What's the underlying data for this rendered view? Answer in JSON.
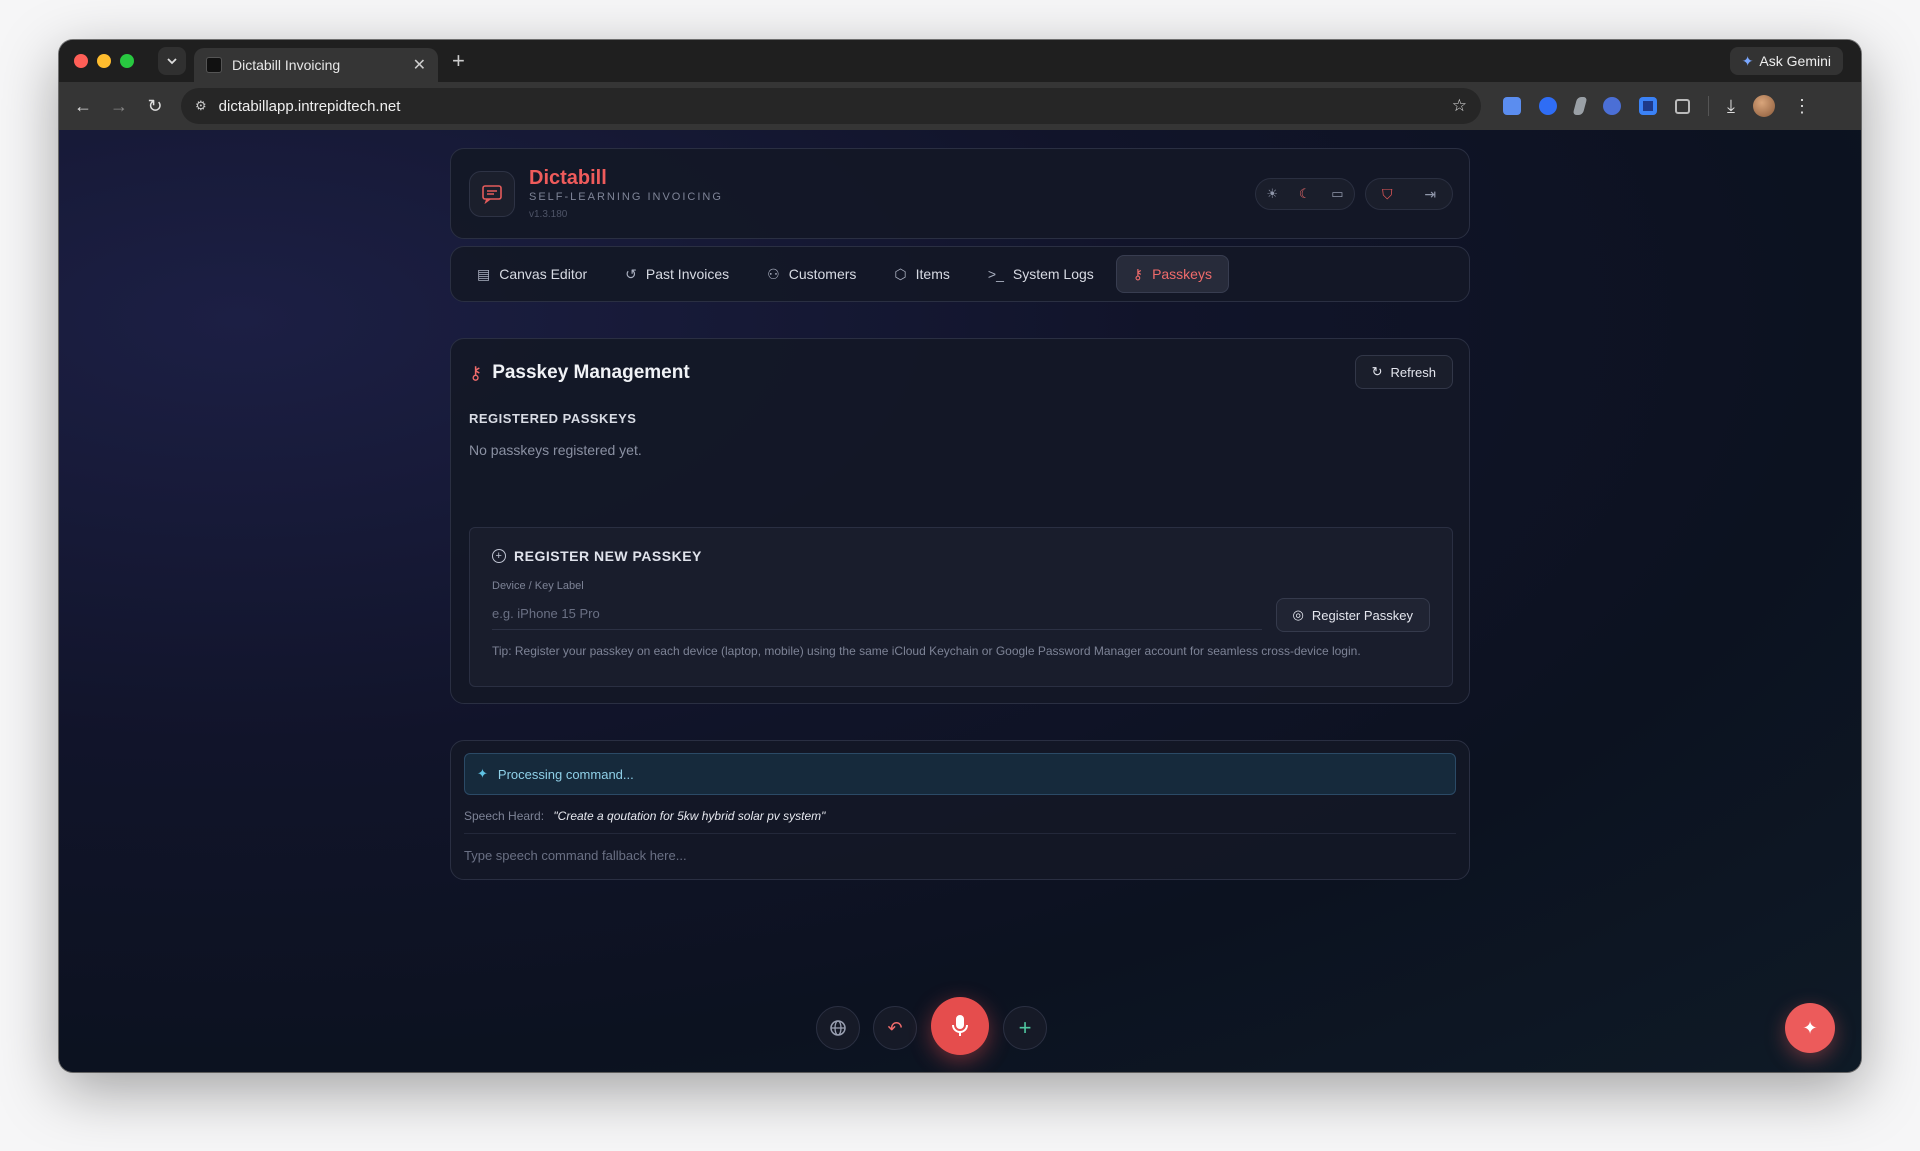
{
  "browser": {
    "tab_title": "Dictabill Invoicing",
    "new_tab": "+",
    "tab_close": "✕",
    "ask_gemini": "Ask Gemini",
    "url": "dictabillapp.intrepidtech.net"
  },
  "header": {
    "app_name": "Dictabill",
    "tagline": "SELF-LEARNING INVOICING",
    "version": "v1.3.180"
  },
  "nav": {
    "items": [
      {
        "label": "Canvas Editor",
        "icon": "document-icon"
      },
      {
        "label": "Past Invoices",
        "icon": "history-icon"
      },
      {
        "label": "Customers",
        "icon": "users-icon"
      },
      {
        "label": "Items",
        "icon": "box-icon"
      },
      {
        "label": "System Logs",
        "icon": "terminal-icon"
      },
      {
        "label": "Passkeys",
        "icon": "key-icon",
        "active": true
      }
    ]
  },
  "passkeys": {
    "title": "Passkey Management",
    "refresh_label": "Refresh",
    "registered_title": "REGISTERED PASSKEYS",
    "empty_text": "No passkeys registered yet.",
    "register": {
      "title": "REGISTER NEW PASSKEY",
      "field_label": "Device / Key Label",
      "placeholder": "e.g. iPhone 15 Pro",
      "button_label": "Register Passkey",
      "tip": "Tip: Register your passkey on each device (laptop, mobile) using the same iCloud Keychain or Google Password Manager account for seamless cross-device login."
    }
  },
  "command": {
    "status": "Processing command...",
    "heard_label": "Speech Heard:",
    "heard_text": "\"Create a qoutation for 5kw hybrid solar pv system\"",
    "fallback_placeholder": "Type speech command fallback here..."
  },
  "colors": {
    "accent": "#ef5b5b",
    "background": "#11142a",
    "processing": "#162a3c"
  }
}
